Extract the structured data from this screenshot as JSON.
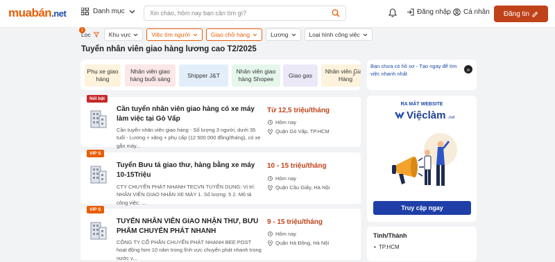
{
  "header": {
    "logo_main": "muabán",
    "logo_tld": ".net",
    "category_label": "Danh mục",
    "search_placeholder": "Xin chào, hôm nay bạn cần tìm gì?",
    "login_label": "Đăng nhập",
    "profile_label": "Cá nhân",
    "post_label": "Đăng tin"
  },
  "filters": {
    "badge_count": "1",
    "items": [
      {
        "label": "Lọc",
        "state": "default"
      },
      {
        "label": "Khu vực",
        "state": "default"
      },
      {
        "label": "Việc tìm người",
        "state": "active"
      },
      {
        "label": "Giao chở hàng",
        "state": "active"
      },
      {
        "label": "Lương",
        "state": "default"
      },
      {
        "label": "Loại hình công việc",
        "state": "default"
      }
    ]
  },
  "page_title": "Tuyển nhân viên giao hàng lương cao T2/2025",
  "suggestions": [
    {
      "label": "Phụ xe giao hàng",
      "color": "#fdf3dc"
    },
    {
      "label": "Nhân viên giao hàng buổi sáng",
      "color": "#fbe7e7"
    },
    {
      "label": "Shipper J&T",
      "color": "#e3eefb"
    },
    {
      "label": "Nhân viên giao hàng Shopee",
      "color": "#e5f6ea"
    },
    {
      "label": "Giao gas",
      "color": "#ebe8f8"
    },
    {
      "label": "Nhân viên Giao Hàng",
      "color": "#fdf3dc"
    }
  ],
  "jobs": [
    {
      "badge": "Nổi bật",
      "badge_type": "hot",
      "title": "Cần tuyển nhân viên giao hàng có xe máy làm việc tại Gò Vấp",
      "desc": "Cần tuyển nhân viên giao hàng - Số lượng 3 người, dưới 35 tuổi - Lương + xăng + phụ cấp (12 500 000 đồng/tháng), có xe gắn máy...",
      "salary": "Từ 12,5 triệu/tháng",
      "posted": "Hôm nay",
      "location": "Quận Gò Vấp, TP.HCM"
    },
    {
      "badge": "VIP S",
      "badge_type": "vip",
      "title": "Tuyển Bưu tá giao thư, hàng bằng xe máy 10-15Triệu",
      "desc": "CTY CHUYỂN PHÁT NHANH TECVN TUYỂN DỤNG: Vị trí: NHÂN VIÊN GIAO NHẬN XE MÁY 1. Số lượng: 5 2. Mô tả công việc: ...",
      "salary": "10 - 15 triệu/tháng",
      "posted": "Hôm nay",
      "location": "Quận Cầu Giấy, Hà Nội"
    },
    {
      "badge": "VIP S",
      "badge_type": "vip",
      "title": "TUYỂN NHÂN VIÊN GIAO NHẬN THƯ, BƯU PHẨM CHUYỂN PHÁT NHANH",
      "desc": "CÔNG TY CỔ PHẦN CHUYỂN PHÁT NHANH BEE POST hoạt động hơn 10 năm trong lĩnh vực chuyển phát nhanh trong nước v...",
      "salary": "9 - 15 triệu/tháng",
      "posted": "Hôm nay",
      "location": "Quận Hà Đông, Hà Nội"
    }
  ],
  "sidebar": {
    "notice": "Bạn chưa có hồ sơ - Tạo ngay để tìm việc nhanh nhất",
    "ad_launch": "RA MẮT WEBSITE",
    "ad_brand": "Việclàm",
    "ad_brand_suffix": ".net",
    "ad_cta": "Truy cập ngay",
    "region_heading": "Tỉnh/Thành",
    "region_item": "TP.HCM"
  },
  "colors": {
    "accent": "#e85d04",
    "brand_blue": "#1b4aa8",
    "cta_blue": "#1f3fa8",
    "post_button": "#c0421a"
  }
}
